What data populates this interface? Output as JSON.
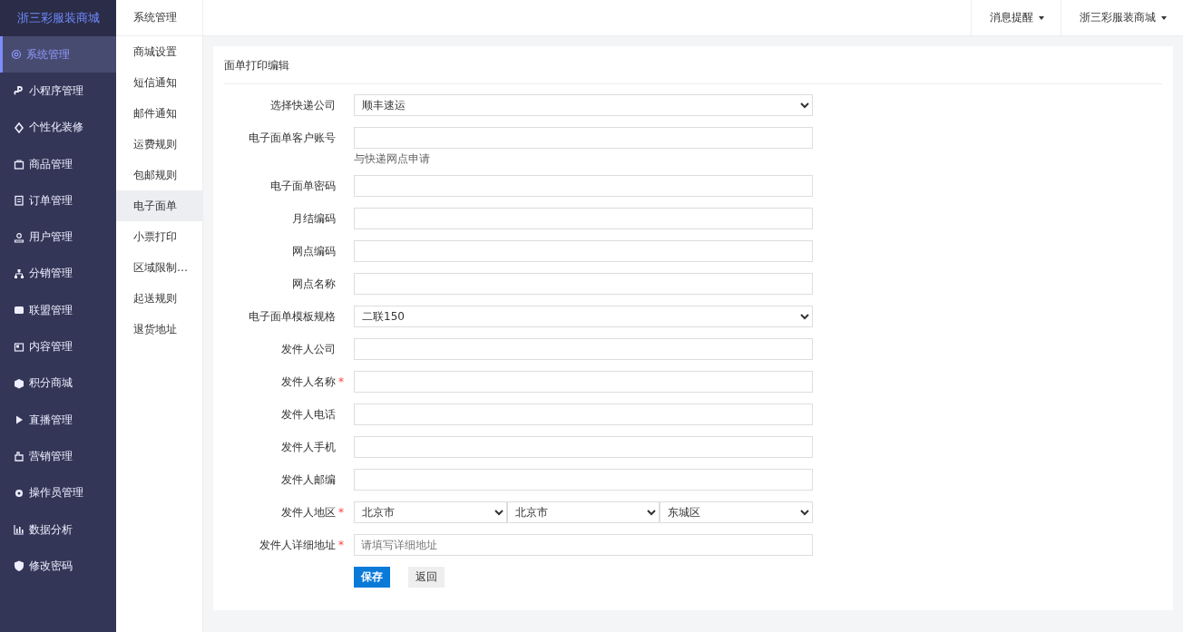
{
  "brand": "浙三彩服装商城",
  "sidebar": {
    "items": [
      {
        "label": "系统管理",
        "selected": true
      },
      {
        "label": "小程序管理",
        "selected": false
      },
      {
        "label": "个性化装修",
        "selected": false
      },
      {
        "label": "商品管理",
        "selected": false
      },
      {
        "label": "订单管理",
        "selected": false
      },
      {
        "label": "用户管理",
        "selected": false
      },
      {
        "label": "分销管理",
        "selected": false
      },
      {
        "label": "联盟管理",
        "selected": false
      },
      {
        "label": "内容管理",
        "selected": false
      },
      {
        "label": "积分商城",
        "selected": false
      },
      {
        "label": "直播管理",
        "selected": false
      },
      {
        "label": "营销管理",
        "selected": false
      },
      {
        "label": "操作员管理",
        "selected": false
      },
      {
        "label": "数据分析",
        "selected": false
      },
      {
        "label": "修改密码",
        "selected": false
      }
    ]
  },
  "submenu": {
    "title": "系统管理",
    "items": [
      {
        "label": "商城设置",
        "selected": false
      },
      {
        "label": "短信通知",
        "selected": false
      },
      {
        "label": "邮件通知",
        "selected": false
      },
      {
        "label": "运费规则",
        "selected": false
      },
      {
        "label": "包邮规则",
        "selected": false
      },
      {
        "label": "电子面单",
        "selected": true
      },
      {
        "label": "小票打印",
        "selected": false
      },
      {
        "label": "区域限制…",
        "selected": false
      },
      {
        "label": "起送规则",
        "selected": false
      },
      {
        "label": "退货地址",
        "selected": false
      }
    ]
  },
  "topbar": {
    "menus": [
      "消息提醒",
      "浙三彩服装商城"
    ]
  },
  "card": {
    "title": "面单打印编辑",
    "fields": [
      {
        "kind": "select",
        "label": "选择快递公司",
        "values": [
          "顺丰速运"
        ]
      },
      {
        "kind": "text",
        "label": "电子面单客户账号",
        "hint": "与快递网点申请"
      },
      {
        "kind": "text",
        "label": "电子面单密码"
      },
      {
        "kind": "text",
        "label": "月结编码"
      },
      {
        "kind": "text",
        "label": "网点编码"
      },
      {
        "kind": "text",
        "label": "网点名称"
      },
      {
        "kind": "select",
        "label": "电子面单模板规格",
        "values": [
          "二联150"
        ]
      },
      {
        "kind": "text",
        "label": "发件人公司"
      },
      {
        "kind": "text",
        "label": "发件人名称",
        "required_mark": "*"
      },
      {
        "kind": "text",
        "label": "发件人电话"
      },
      {
        "kind": "text",
        "label": "发件人手机"
      },
      {
        "kind": "text",
        "label": "发件人邮编"
      },
      {
        "kind": "select",
        "label": "发件人地区",
        "required_mark": "*",
        "values": [
          "北京市",
          "北京市",
          "东城区"
        ]
      },
      {
        "kind": "text",
        "label": "发件人详细地址",
        "required_mark": "*",
        "placeholder": "请填写详细地址"
      }
    ],
    "buttons": [
      {
        "label": "保存",
        "kind": "primary"
      },
      {
        "label": "返回",
        "kind": "default"
      }
    ]
  }
}
